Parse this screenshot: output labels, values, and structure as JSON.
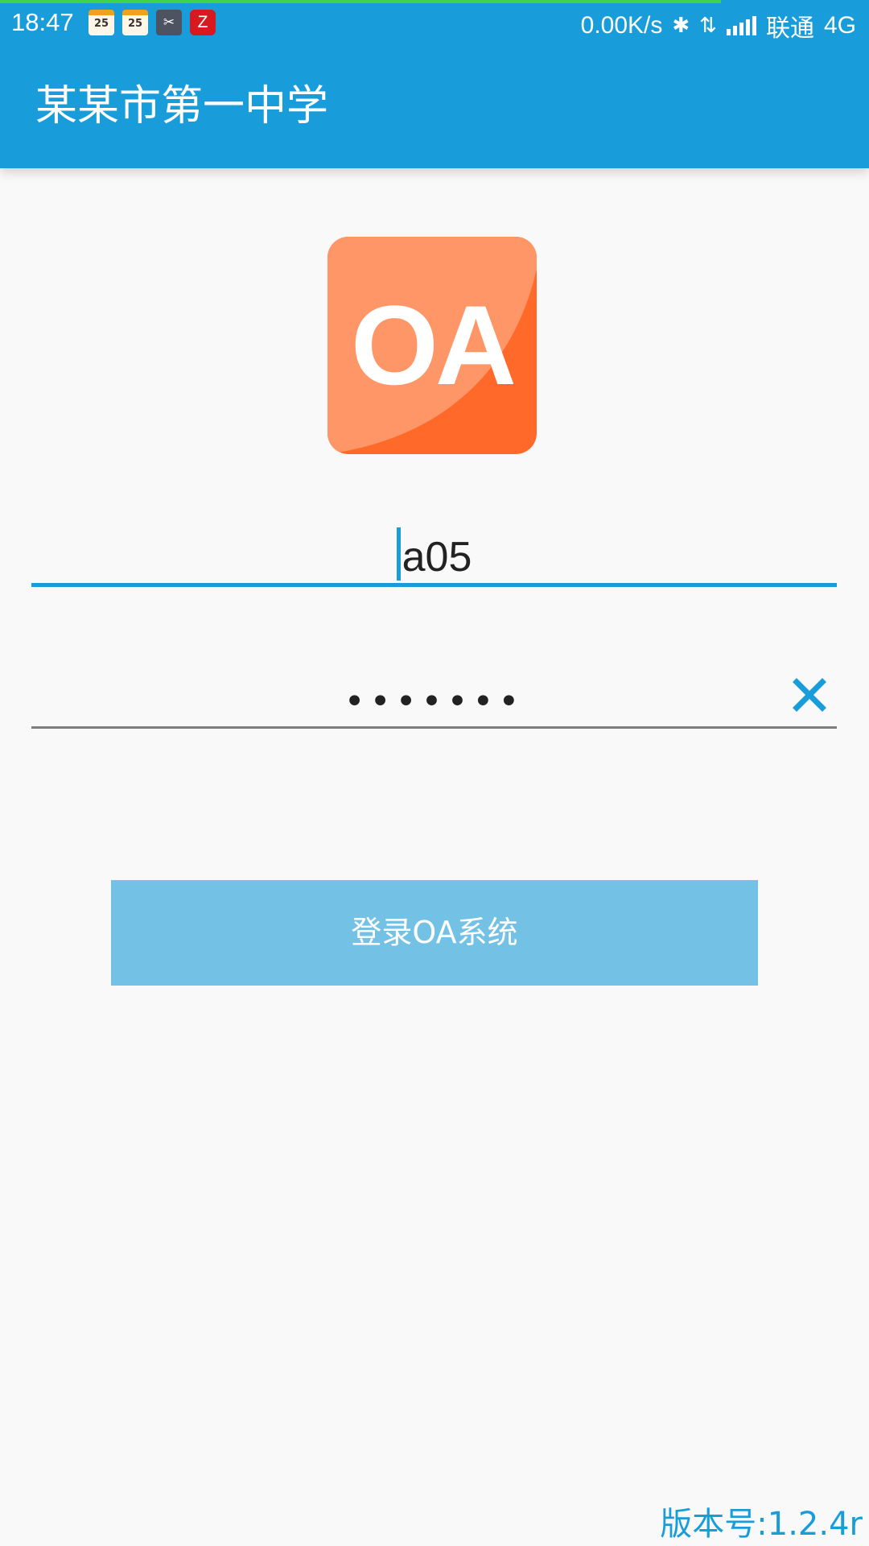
{
  "theme": {
    "primary": "#199dda",
    "button": "#74c1e6",
    "logo": "#ff6a2a",
    "background": "#f9f9f9"
  },
  "status_bar": {
    "time": "18:47",
    "notifications": [
      {
        "icon": "calendar-icon",
        "text": "25"
      },
      {
        "icon": "calendar-icon",
        "text": "25"
      },
      {
        "icon": "app-notification-icon"
      },
      {
        "icon": "alarm-app-icon",
        "text": "Z"
      }
    ],
    "network_speed": "0.00K/s",
    "bluetooth_icon": "bluetooth-icon",
    "data_icon": "data-transfer-icon",
    "signal_icon": "signal-icon",
    "carrier": "联通",
    "network_type": "4G",
    "page_load_progress": 0.83
  },
  "app_bar": {
    "title": "某某市第一中学"
  },
  "logo": {
    "text": "OA"
  },
  "form": {
    "username_value": "a05",
    "password_value": "•••••••",
    "clear_icon": "close-icon",
    "login_label": "登录OA系统"
  },
  "footer": {
    "version": "版本号:1.2.4r"
  }
}
